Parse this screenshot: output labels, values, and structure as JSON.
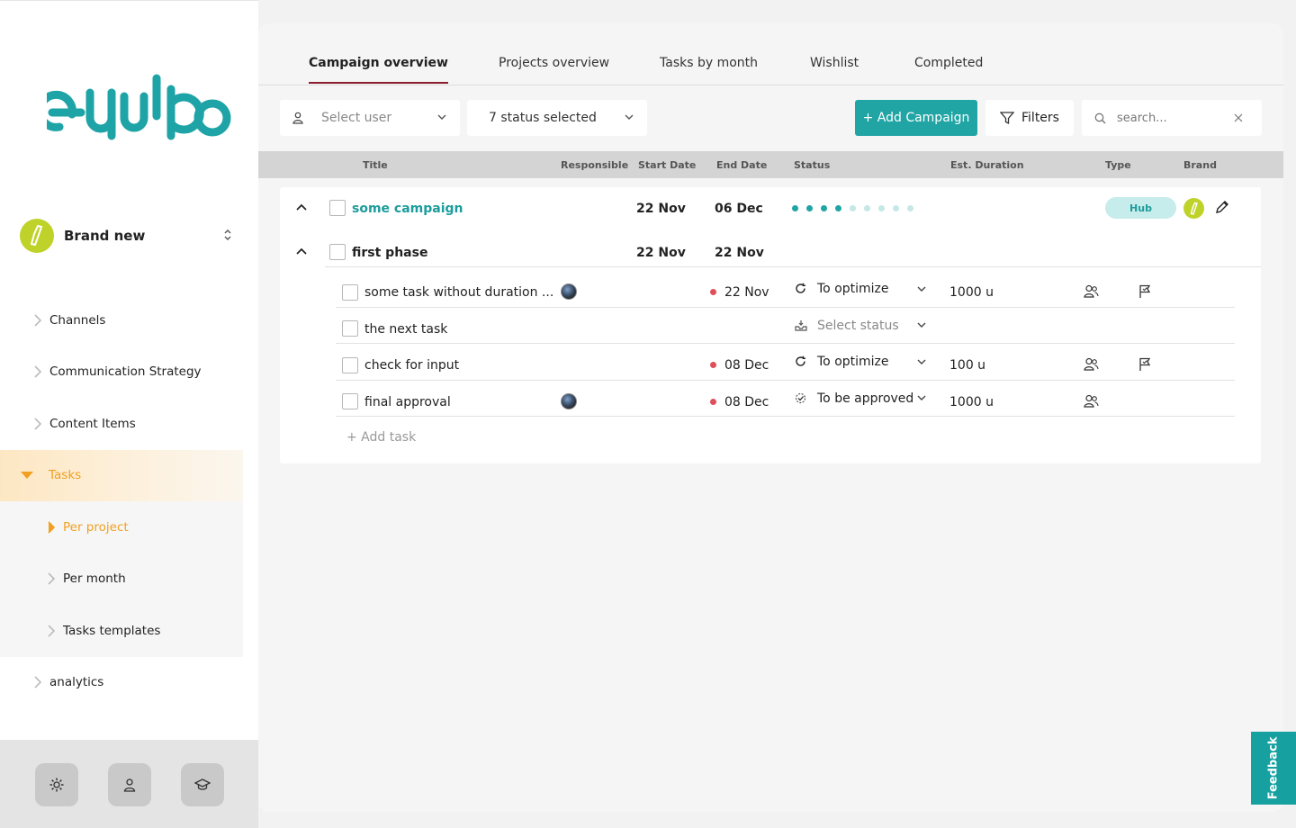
{
  "brand": {
    "logo_text": "equipo",
    "current_brand": "Brand new",
    "accent_color": "#20a4a4"
  },
  "sidebar": {
    "items": [
      {
        "label": "Channels"
      },
      {
        "label": "Communication Strategy"
      },
      {
        "label": "Content Items"
      },
      {
        "label": "Tasks"
      },
      {
        "label": "Per project"
      },
      {
        "label": "Per month"
      },
      {
        "label": "Tasks templates"
      },
      {
        "label": "analytics"
      }
    ],
    "footer": {
      "icons": [
        "gear-icon",
        "user-icon",
        "graduation-cap-icon"
      ]
    }
  },
  "tabs": [
    {
      "label": "Campaign overview"
    },
    {
      "label": "Projects overview"
    },
    {
      "label": "Tasks by month"
    },
    {
      "label": "Wishlist"
    },
    {
      "label": "Completed"
    }
  ],
  "toolbar": {
    "user_placeholder": "Select user",
    "status_value": "7 status selected",
    "add_campaign": "+ Add Campaign",
    "filters": "Filters",
    "search_placeholder": "search..."
  },
  "table": {
    "columns": [
      "Title",
      "Responsible",
      "Start Date",
      "End Date",
      "Status",
      "Est. Duration",
      "Type",
      "Brand"
    ],
    "campaign": {
      "title": "some campaign",
      "start": "22 Nov",
      "end": "06 Dec",
      "progress_done": 4,
      "progress_total": 9,
      "type": "Hub"
    },
    "phase": {
      "title": "first phase",
      "start": "22 Nov",
      "end": "22 Nov"
    },
    "tasks": [
      {
        "title": "some task without duration ...",
        "end": "22 Nov",
        "status": "To optimize",
        "duration": "1000 u"
      },
      {
        "title": "the next task",
        "end": "",
        "status": "Select status",
        "duration": ""
      },
      {
        "title": "check for input",
        "end": "08 Dec",
        "status": "To optimize",
        "duration": "100 u"
      },
      {
        "title": "final approval",
        "end": "08 Dec",
        "status": "To be approved",
        "duration": "1000 u"
      }
    ],
    "add_task": "+ Add task"
  },
  "feedback": "Feedback"
}
